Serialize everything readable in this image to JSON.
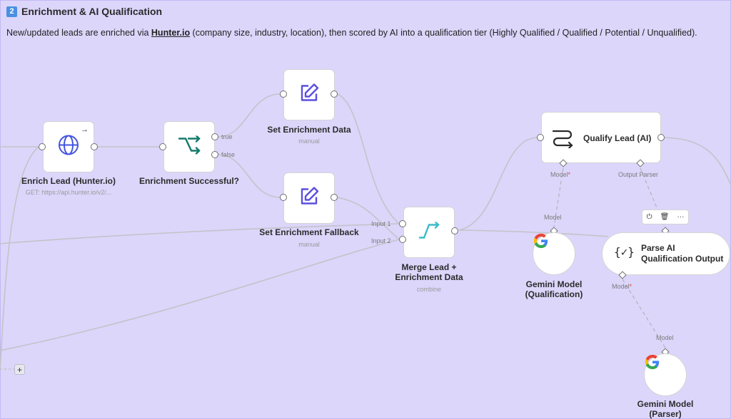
{
  "section": {
    "badge": "2",
    "title": "Enrichment & AI Qualification",
    "desc_before": "New/updated leads are enriched via ",
    "desc_link": "Hunter.io",
    "desc_after": " (company size, industry, location), then scored by AI into a qualification tier (Highly Qualified / Qualified / Potential / Unqualified)."
  },
  "nodes": {
    "enrich_lead": {
      "label": "Enrich Lead (Hunter.io)",
      "subtitle": "GET: https://api.hunter.io/v2/..."
    },
    "enrichment_successful": {
      "label": "Enrichment Successful?",
      "out_true": "true",
      "out_false": "false"
    },
    "set_enrichment_data": {
      "label": "Set Enrichment Data",
      "subtitle": "manual"
    },
    "set_enrichment_fallback": {
      "label": "Set Enrichment Fallback",
      "subtitle": "manual"
    },
    "merge": {
      "label_line1": "Merge Lead +",
      "label_line2": "Enrichment Data",
      "subtitle": "combine",
      "input1": "Input 1",
      "input2": "Input 2"
    },
    "qualify_lead": {
      "label": "Qualify Lead (AI)",
      "model_port": "Model",
      "output_parser_port": "Output Parser"
    },
    "gemini_qualification": {
      "port_label": "Model",
      "label_line1": "Gemini Model",
      "label_line2": "(Qualification)"
    },
    "parse_output": {
      "label_line1": "Parse AI",
      "label_line2": "Qualification Output",
      "model_port": "Model"
    },
    "gemini_parser": {
      "port_label": "Model",
      "label_line1": "Gemini Model",
      "label_line2": "(Parser)"
    }
  },
  "toolbar": {
    "power": "⏻",
    "delete": "🗑",
    "more": "···"
  },
  "add_button": "+",
  "required_mark": "*",
  "colors": {
    "canvas": "#dcd6fb",
    "wire": "#c3c3c8",
    "branch_accent": "#137a6a",
    "merge_accent": "#3bbcc9",
    "edit_accent": "#5a4fe0",
    "http_accent": "#4454e0"
  }
}
